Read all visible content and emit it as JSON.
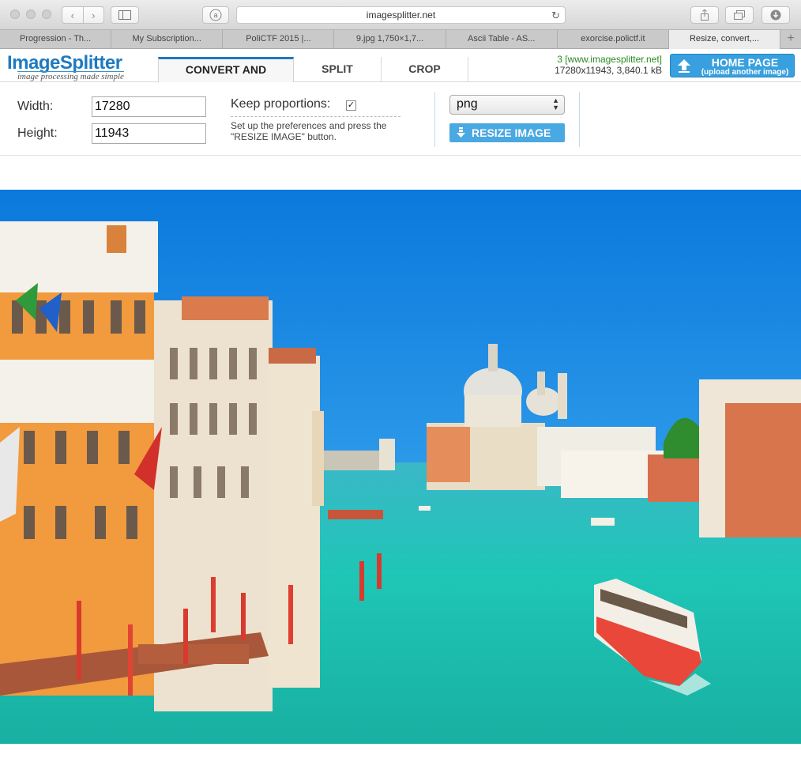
{
  "browser": {
    "url": "imagesplitter.net",
    "tabs": [
      "Progression - Th...",
      "My Subscription...",
      "PoliCTF 2015 |...",
      "9.jpg 1,750×1,7...",
      "Ascii Table - AS...",
      "exorcise.polictf.it",
      "Resize, convert,..."
    ],
    "active_tab": 6
  },
  "site": {
    "logo": "ImageSplitter",
    "tagline": "image processing made simple",
    "nav": [
      "CONVERT AND RESIZE",
      "SPLIT IMAGE",
      "CROP IMAGE"
    ],
    "stats_line1": "3 [www.imagesplitter.net]",
    "stats_line2": "17280x11943, 3,840.1 kB",
    "home_title": "HOME PAGE",
    "home_sub": "(upload another image)"
  },
  "form": {
    "width_label": "Width:",
    "width_value": "17280",
    "height_label": "Height:",
    "height_value": "11943",
    "keep_label": "Keep proportions:",
    "keep_checked": "✓",
    "hint": "Set up the preferences and press the \"RESIZE IMAGE\" button.",
    "format": "png",
    "resize_button": "RESIZE IMAGE"
  },
  "colors": {
    "brand": "#1e7ac0",
    "button": "#4aa8e2",
    "sky": "#1688e0",
    "water": "#1bc4b0"
  }
}
